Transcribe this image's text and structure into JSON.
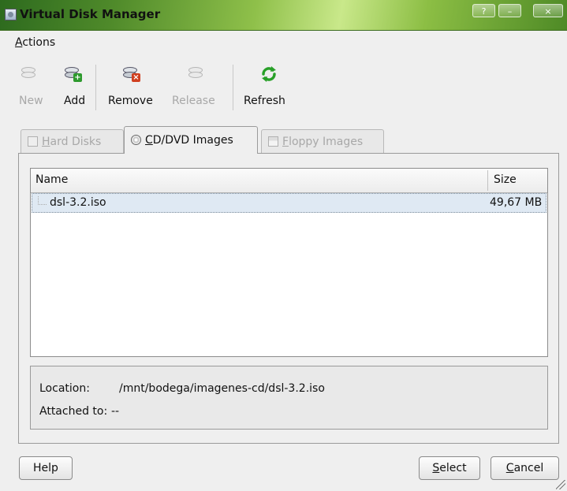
{
  "window": {
    "title": "Virtual Disk Manager",
    "controls": [
      "?",
      "–",
      "×"
    ]
  },
  "menu": [
    {
      "label": "Actions",
      "mnemonic": "A",
      "rest": "ctions"
    }
  ],
  "toolbar": {
    "new": "New",
    "add": "Add",
    "remove": "Remove",
    "release": "Release",
    "refresh": "Refresh"
  },
  "tabs": [
    {
      "mnemonic": "H",
      "rest": "ard Disks",
      "label": "Hard Disks",
      "active": false
    },
    {
      "mnemonic": "C",
      "rest": "D/DVD Images",
      "label": "CD/DVD Images",
      "active": true
    },
    {
      "mnemonic": "F",
      "rest": "loppy Images",
      "label": "Floppy Images",
      "active": false
    }
  ],
  "list": {
    "columns": [
      "Name",
      "Size"
    ],
    "rows": [
      {
        "name": "dsl-3.2.iso",
        "size": "49,67 MB",
        "selected": true
      }
    ]
  },
  "info": {
    "location_label": "Location:",
    "location_value": "/mnt/bodega/imagenes-cd/dsl-3.2.iso",
    "attached_label": "Attached to:",
    "attached_value": "--"
  },
  "buttons": {
    "help": "Help",
    "select_mn": "S",
    "select_rest": "elect",
    "select": "Select",
    "cancel_mn": "C",
    "cancel_rest": "ancel",
    "cancel": "Cancel"
  },
  "colors": {
    "titlebar": "#6fa83a",
    "selection": "#dfe9f3",
    "add": "#2e9a2e",
    "remove": "#d04020",
    "refresh": "#28a028"
  },
  "icons": [
    "disk-icon",
    "disk-add-icon",
    "disk-remove-icon",
    "disk-release-icon",
    "refresh-icon",
    "cd-icon",
    "floppy-icon"
  ]
}
